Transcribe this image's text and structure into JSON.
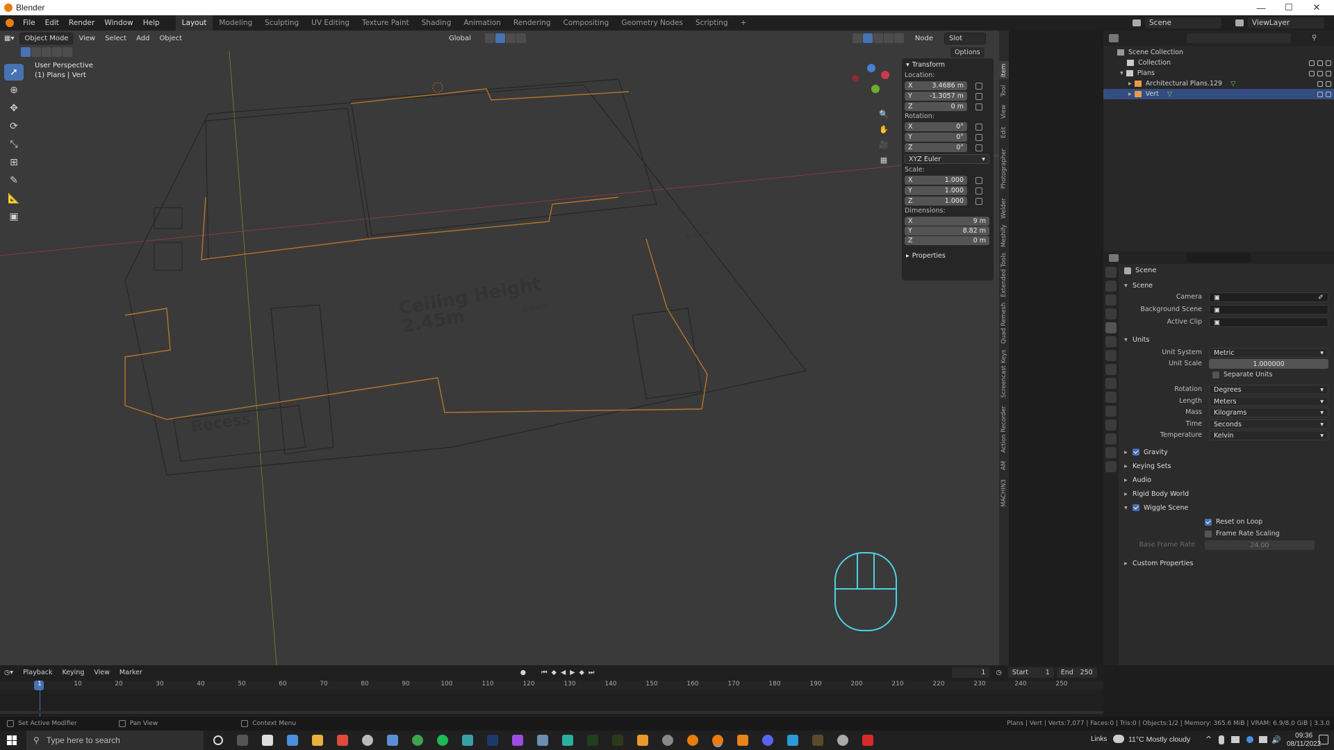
{
  "app": {
    "title": "Blender"
  },
  "menu": {
    "items": [
      "File",
      "Edit",
      "Render",
      "Window",
      "Help"
    ]
  },
  "workspaces": {
    "tabs": [
      "Layout",
      "Modeling",
      "Sculpting",
      "UV Editing",
      "Texture Paint",
      "Shading",
      "Animation",
      "Rendering",
      "Compositing",
      "Geometry Nodes",
      "Scripting"
    ],
    "active": "Layout",
    "add": "+"
  },
  "topbar_right": {
    "scene": "Scene",
    "view_layer": "ViewLayer"
  },
  "viewport_header": {
    "mode": "Object Mode",
    "view": "View",
    "select": "Select",
    "add": "Add",
    "object": "Object",
    "orientation": "Global",
    "node": "Node",
    "slot": "Slot",
    "options": "Options"
  },
  "viewport_info": {
    "line1": "User Perspective",
    "line2": "(1) Plans | Vert"
  },
  "floor_plan": {
    "text1": "Ceiling Height",
    "text2": "2.45m",
    "text3": "Recess",
    "level1": "-0.000m",
    "level2": "-0.020m"
  },
  "npanel": {
    "transform": "Transform",
    "location_label": "Location:",
    "location": [
      {
        "axis": "X",
        "value": "3.4686 m"
      },
      {
        "axis": "Y",
        "value": "-1.3057 m"
      },
      {
        "axis": "Z",
        "value": "0 m"
      }
    ],
    "rotation_label": "Rotation:",
    "rotation": [
      {
        "axis": "X",
        "value": "0°"
      },
      {
        "axis": "Y",
        "value": "0°"
      },
      {
        "axis": "Z",
        "value": "0°"
      }
    ],
    "rotation_mode": "XYZ Euler",
    "scale_label": "Scale:",
    "scale": [
      {
        "axis": "X",
        "value": "1.000"
      },
      {
        "axis": "Y",
        "value": "1.000"
      },
      {
        "axis": "Z",
        "value": "1.000"
      }
    ],
    "dimensions_label": "Dimensions:",
    "dimensions": [
      {
        "axis": "X",
        "value": "9 m"
      },
      {
        "axis": "Y",
        "value": "8.82 m"
      },
      {
        "axis": "Z",
        "value": "0 m"
      }
    ],
    "properties": "Properties"
  },
  "side_tabs": [
    "Item",
    "Tool",
    "View",
    "Edit",
    "Photographer",
    "Welder",
    "Meshify",
    "Extended Tools",
    "Quad Remesh",
    "Screencast Keys",
    "Action Recorder",
    "AM",
    "MACHIN3"
  ],
  "outliner": {
    "root": "Scene Collection",
    "items": [
      {
        "name": "Collection",
        "indent": 1,
        "selected": false
      },
      {
        "name": "Plans",
        "indent": 1,
        "selected": false
      },
      {
        "name": "Architectural Plans.129",
        "indent": 2,
        "selected": false
      },
      {
        "name": "Vert",
        "indent": 2,
        "selected": true
      }
    ]
  },
  "properties": {
    "header": "Scene",
    "scene_section": "Scene",
    "camera_label": "Camera",
    "bg_scene_label": "Background Scene",
    "active_clip_label": "Active Clip",
    "units_section": "Units",
    "unit_system_label": "Unit System",
    "unit_system": "Metric",
    "unit_scale_label": "Unit Scale",
    "unit_scale": "1.000000",
    "separate_units": "Separate Units",
    "rotation_label": "Rotation",
    "rotation": "Degrees",
    "length_label": "Length",
    "length": "Meters",
    "mass_label": "Mass",
    "mass": "Kilograms",
    "time_label": "Time",
    "time": "Seconds",
    "temperature_label": "Temperature",
    "temperature": "Kelvin",
    "gravity": "Gravity",
    "keying_sets": "Keying Sets",
    "audio": "Audio",
    "rigid_body_world": "Rigid Body World",
    "wiggle_scene": "Wiggle Scene",
    "reset_on_loop": "Reset on Loop",
    "frame_rate_scaling": "Frame Rate Scaling",
    "base_frame_rate_label": "Base Frame Rate",
    "base_frame_rate": "24.00",
    "custom_properties": "Custom Properties"
  },
  "timeline": {
    "playback": "Playback",
    "keying": "Keying",
    "view": "View",
    "marker": "Marker",
    "current_frame": "1",
    "start_label": "Start",
    "start": "1",
    "end_label": "End",
    "end": "250",
    "ticks": [
      "1",
      "10",
      "20",
      "30",
      "40",
      "50",
      "60",
      "70",
      "80",
      "90",
      "100",
      "110",
      "120",
      "130",
      "140",
      "150",
      "160",
      "170",
      "180",
      "190",
      "200",
      "210",
      "220",
      "230",
      "240",
      "250"
    ]
  },
  "statusbar": {
    "left1": "Set Active Modifier",
    "left2": "Pan View",
    "left3": "Context Menu",
    "right": "Plans | Vert | Verts:7,077 | Faces:0 | Tris:0 | Objects:1/2 | Memory: 365.6 MiB | VRAM: 6.9/8.0 GiB | 3.3.0"
  },
  "taskbar": {
    "search_placeholder": "Type here to search",
    "links": "Links",
    "weather": "11°C  Mostly cloudy",
    "time": "09:36",
    "date": "08/11/2022"
  }
}
